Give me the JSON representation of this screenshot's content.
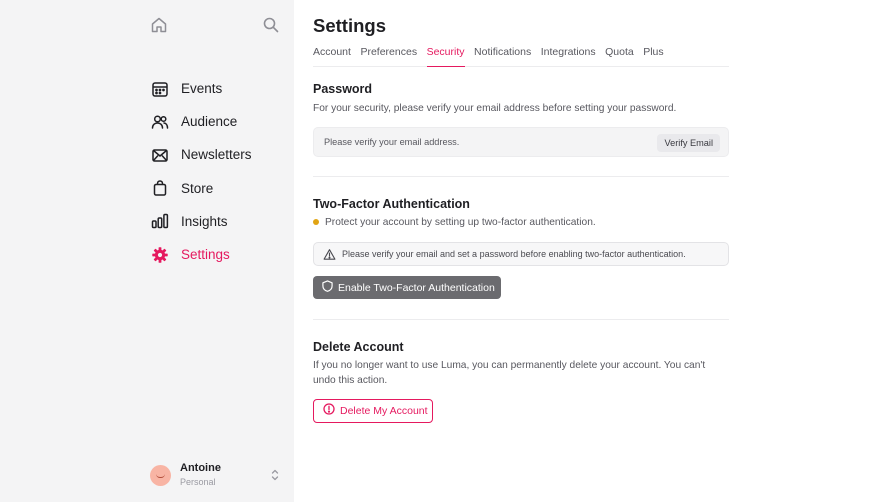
{
  "sidebar": {
    "items": [
      {
        "label": "Events",
        "icon": "calendar-icon"
      },
      {
        "label": "Audience",
        "icon": "users-icon"
      },
      {
        "label": "Newsletters",
        "icon": "mail-icon"
      },
      {
        "label": "Store",
        "icon": "bag-icon"
      },
      {
        "label": "Insights",
        "icon": "bar-chart-icon"
      },
      {
        "label": "Settings",
        "icon": "gear-icon",
        "active": true
      }
    ],
    "user": {
      "name": "Antoine",
      "subtitle": "Personal"
    }
  },
  "main": {
    "title": "Settings",
    "tabs": [
      {
        "label": "Account"
      },
      {
        "label": "Preferences"
      },
      {
        "label": "Security",
        "active": true
      },
      {
        "label": "Notifications"
      },
      {
        "label": "Integrations"
      },
      {
        "label": "Quota"
      },
      {
        "label": "Plus"
      }
    ],
    "password": {
      "title": "Password",
      "description": "For your security, please verify your email address before setting your password.",
      "notice": "Please verify your email address.",
      "verify_label": "Verify Email"
    },
    "two_factor": {
      "title": "Two-Factor Authentication",
      "status": "Protect your account by setting up two-factor authentication.",
      "warning": "Please verify your email and set a password before enabling two-factor authentication.",
      "button_label": "Enable Two-Factor Authentication"
    },
    "delete_account": {
      "title": "Delete Account",
      "description": "If you no longer want to use Luma, you can permanently delete your account. You can't undo this action.",
      "button_label": "Delete My Account"
    }
  },
  "colors": {
    "accent": "#e5195f",
    "status_dot": "#e1a413",
    "sidebar_bg": "#f4f4f5",
    "disabled_button": "#6b6b6f"
  }
}
